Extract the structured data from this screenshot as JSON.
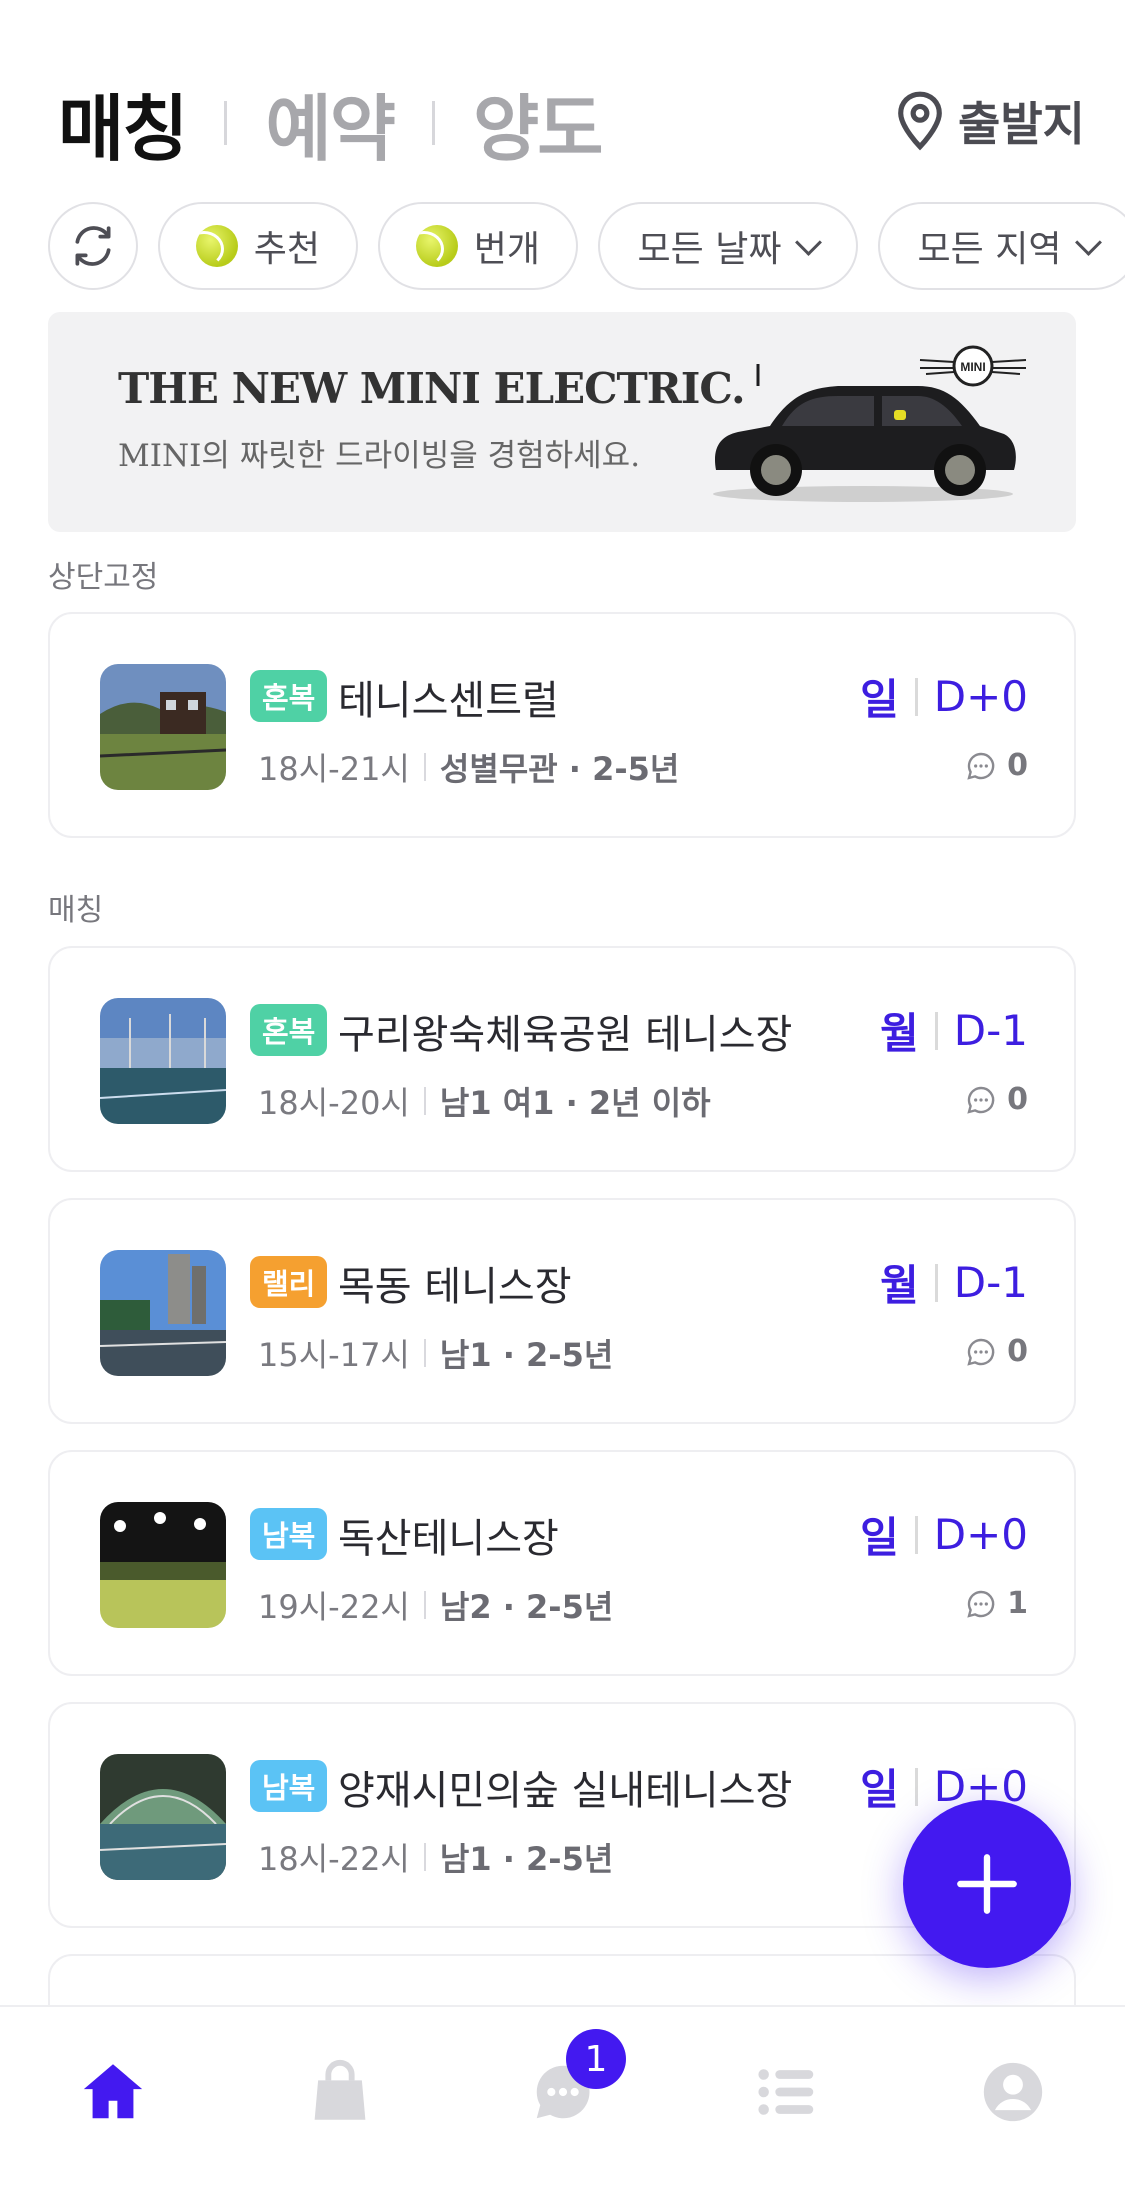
{
  "header": {
    "tabs": [
      {
        "label": "매칭",
        "active": true
      },
      {
        "label": "예약",
        "active": false
      },
      {
        "label": "양도",
        "active": false
      }
    ],
    "origin_label": "출발지"
  },
  "filters": {
    "refresh_icon": "refresh-icon",
    "chips": [
      {
        "label": "추천",
        "icon": "tennis-ball-icon"
      },
      {
        "label": "번개",
        "icon": "tennis-ball-icon"
      },
      {
        "label": "모든 날짜",
        "icon": "chevron-down-icon"
      },
      {
        "label": "모든 지역",
        "icon": "chevron-down-icon"
      }
    ]
  },
  "ad": {
    "title": "THE NEW MINI ELECTRIC.",
    "subtitle": "MINI의 짜릿한 드라이빙을 경험하세요.",
    "logo_text": "MINI"
  },
  "sections": {
    "pinned_label": "상단고정",
    "matching_label": "매칭"
  },
  "cards": [
    {
      "badge": "혼복",
      "badge_color": "#4fd1a5",
      "title": "테니스센트럴",
      "time": "18시-21시",
      "conditions": "성별무관 · 2-5년",
      "day": "일",
      "dday": "D+0",
      "comments": "0"
    },
    {
      "badge": "혼복",
      "badge_color": "#4fd1a5",
      "title": "구리왕숙체육공원 테니스장",
      "time": "18시-20시",
      "conditions": "남1 여1 · 2년 이하",
      "day": "월",
      "dday": "D-1",
      "comments": "0"
    },
    {
      "badge": "랠리",
      "badge_color": "#f5a030",
      "title": "목동 테니스장",
      "time": "15시-17시",
      "conditions": "남1 · 2-5년",
      "day": "월",
      "dday": "D-1",
      "comments": "0"
    },
    {
      "badge": "남복",
      "badge_color": "#5bc3f5",
      "title": "독산테니스장",
      "time": "19시-22시",
      "conditions": "남2 · 2-5년",
      "day": "일",
      "dday": "D+0",
      "comments": "1"
    },
    {
      "badge": "남복",
      "badge_color": "#5bc3f5",
      "title": "양재시민의숲 실내테니스장",
      "time": "18시-22시",
      "conditions": "남1 · 2-5년",
      "day": "일",
      "dday": "D+0",
      "comments": ""
    }
  ],
  "bottom_nav": {
    "items": [
      "home-icon",
      "shopping-bag-icon",
      "chat-icon",
      "list-icon",
      "profile-icon"
    ],
    "chat_badge": "1"
  },
  "colors": {
    "accent": "#4319f0",
    "nav_inactive": "#d8d8dc"
  }
}
